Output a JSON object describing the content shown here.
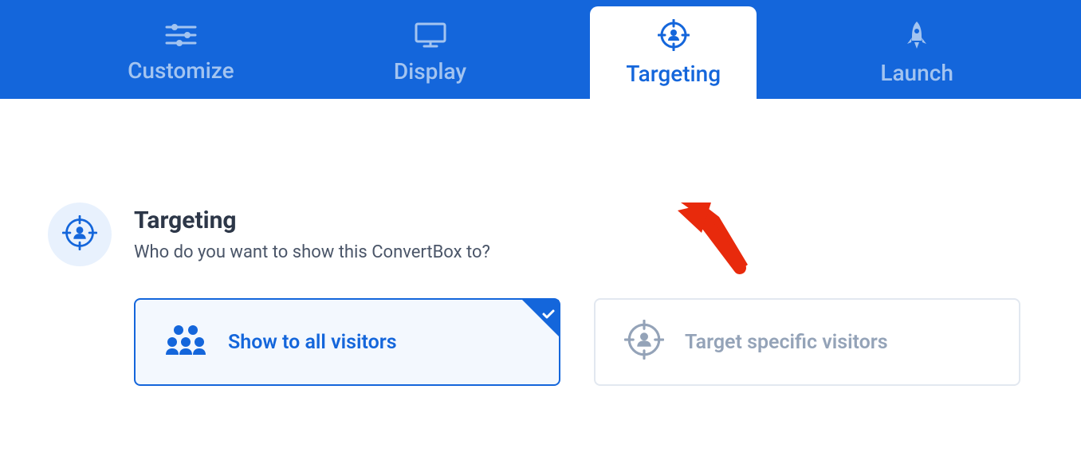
{
  "nav": {
    "tabs": [
      {
        "label": "Customize",
        "active": false
      },
      {
        "label": "Display",
        "active": false
      },
      {
        "label": "Targeting",
        "active": true
      },
      {
        "label": "Launch",
        "active": false
      }
    ]
  },
  "section": {
    "title": "Targeting",
    "subtitle": "Who do you want to show this ConvertBox to?"
  },
  "options": {
    "all_visitors": "Show to all visitors",
    "specific_visitors": "Target specific visitors"
  }
}
